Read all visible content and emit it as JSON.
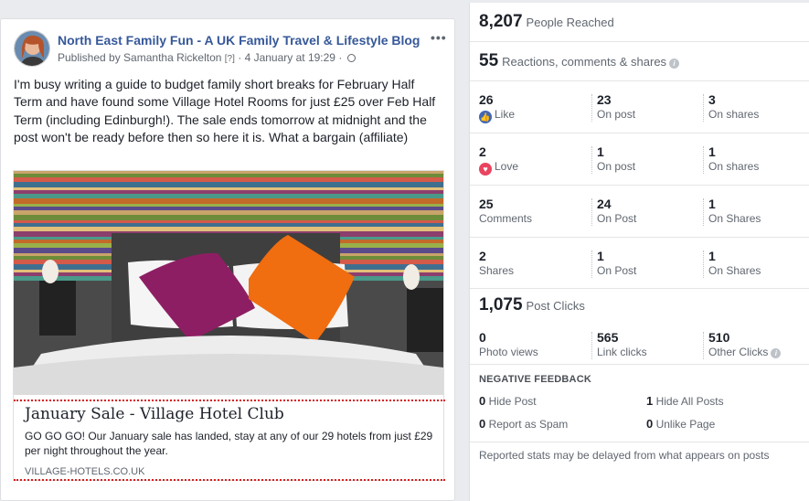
{
  "post": {
    "page_name": "North East Family Fun - A UK Family Travel & Lifestyle Blog",
    "published_by": "Published by Samantha Rickelton",
    "help_marker": "[?]",
    "timestamp": "· 4 January at 19:29 ·",
    "more_icon": "ellipsis-icon",
    "text": "I'm busy writing a guide to budget family short breaks for February Half Term and have found some Village Hotel Rooms for just £25 over Feb Half Term (including Edinburgh!). The sale ends tomorrow at midnight and the post won't be ready before then so here it is. What a bargain (affiliate)",
    "link": {
      "title": "January Sale - Village Hotel Club",
      "description": "GO GO GO! Our January sale has landed, stay at any of our 29 hotels from just £29 per night throughout the year.",
      "domain": "VILLAGE-HOTELS.CO.UK"
    }
  },
  "stats": {
    "people_reached": {
      "value": "8,207",
      "label": "People Reached"
    },
    "reactions_total": {
      "value": "55",
      "label": "Reactions, comments & shares"
    },
    "rows": [
      {
        "total": "26",
        "label": "Like",
        "icon": "like-icon",
        "on_post": "23",
        "on_post_label": "On post",
        "on_shares": "3",
        "on_shares_label": "On shares"
      },
      {
        "total": "2",
        "label": "Love",
        "icon": "love-icon",
        "on_post": "1",
        "on_post_label": "On post",
        "on_shares": "1",
        "on_shares_label": "On shares"
      },
      {
        "total": "25",
        "label": "Comments",
        "on_post": "24",
        "on_post_label": "On Post",
        "on_shares": "1",
        "on_shares_label": "On Shares"
      },
      {
        "total": "2",
        "label": "Shares",
        "on_post": "1",
        "on_post_label": "On Post",
        "on_shares": "1",
        "on_shares_label": "On Shares"
      }
    ],
    "post_clicks": {
      "value": "1,075",
      "label": "Post Clicks"
    },
    "clicks": [
      {
        "value": "0",
        "label": "Photo views"
      },
      {
        "value": "565",
        "label": "Link clicks"
      },
      {
        "value": "510",
        "label": "Other Clicks"
      }
    ],
    "negative": {
      "title": "NEGATIVE FEEDBACK",
      "items": [
        {
          "value": "0",
          "label": "Hide Post"
        },
        {
          "value": "1",
          "label": "Hide All Posts"
        },
        {
          "value": "0",
          "label": "Report as Spam"
        },
        {
          "value": "0",
          "label": "Unlike Page"
        }
      ]
    },
    "footnote": "Reported stats may be delayed from what appears on posts"
  }
}
